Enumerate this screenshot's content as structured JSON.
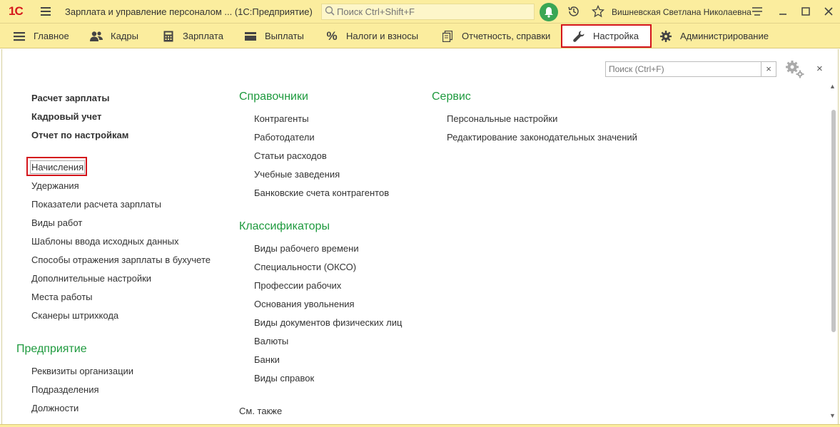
{
  "titlebar": {
    "logo": "1С",
    "app_title": "Зарплата и управление персоналом ...  (1С:Предприятие)",
    "search_placeholder": "Поиск Ctrl+Shift+F",
    "user_name": "Вишневская Светлана Николаевна"
  },
  "sections": [
    {
      "label": "Главное",
      "icon": "hamburger-icon"
    },
    {
      "label": "Кадры",
      "icon": "people-icon"
    },
    {
      "label": "Зарплата",
      "icon": "calculator-icon"
    },
    {
      "label": "Выплаты",
      "icon": "wallet-icon"
    },
    {
      "label": "Налоги и взносы",
      "icon": "percent-icon"
    },
    {
      "label": "Отчетность, справки",
      "icon": "documents-icon"
    },
    {
      "label": "Настройка",
      "icon": "wrench-icon",
      "active": true
    },
    {
      "label": "Администрирование",
      "icon": "gear-icon"
    }
  ],
  "panel": {
    "search_placeholder": "Поиск (Ctrl+F)",
    "clear": "×",
    "close": "×"
  },
  "col1": {
    "bold_items": [
      "Расчет зарплаты",
      "Кадровый учет",
      "Отчет по настройкам"
    ],
    "items": [
      "Начисления",
      "Удержания",
      "Показатели расчета зарплаты",
      "Виды работ",
      "Шаблоны ввода исходных данных",
      "Способы отражения зарплаты в бухучете",
      "Дополнительные настройки",
      "Места работы",
      "Сканеры штрихкода"
    ],
    "group2_title": "Предприятие",
    "group2_items": [
      "Реквизиты организации",
      "Подразделения",
      "Должности"
    ]
  },
  "col2": {
    "group1_title": "Справочники",
    "group1_items": [
      "Контрагенты",
      "Работодатели",
      "Статьи расходов",
      "Учебные заведения",
      "Банковские счета контрагентов"
    ],
    "group2_title": "Классификаторы",
    "group2_items": [
      "Виды рабочего времени",
      "Специальности (ОКСО)",
      "Профессии рабочих",
      "Основания увольнения",
      "Виды документов физических лиц",
      "Валюты",
      "Банки",
      "Виды справок"
    ],
    "see_also": "См. также"
  },
  "col3": {
    "group1_title": "Сервис",
    "group1_items": [
      "Персональные настройки",
      "Редактирование законодательных значений"
    ]
  },
  "colors": {
    "titlebar_bg": "#fbed9e",
    "group_title": "#1e9a3e",
    "highlight": "#d4151c",
    "bell": "#3aa655"
  }
}
